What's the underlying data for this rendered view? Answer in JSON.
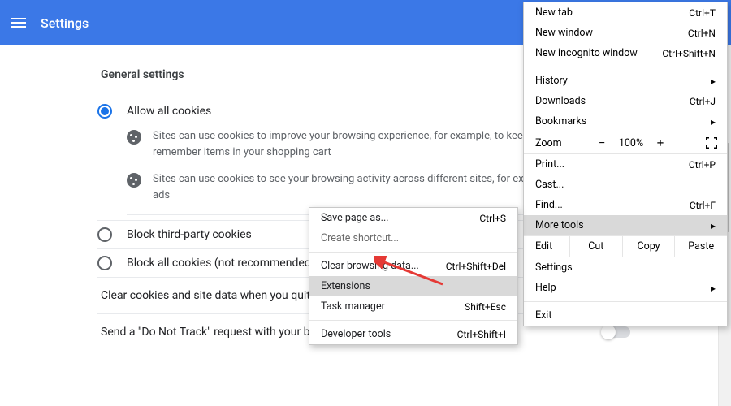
{
  "header": {
    "title": "Settings"
  },
  "section": {
    "title": "General settings",
    "options": [
      {
        "label": "Allow all cookies",
        "checked": true,
        "desc1": "Sites can use cookies to improve your browsing experience, for example, to keep you signed in or to remember items in your shopping cart",
        "desc2": "Sites can use cookies to see your browsing activity across different sites, for example, to personalize ads"
      },
      {
        "label": "Block third-party cookies",
        "checked": false
      },
      {
        "label": "Block all cookies (not recommended)",
        "checked": false
      }
    ],
    "toggles": [
      {
        "label": "Clear cookies and site data when you quit Chrome",
        "on": false
      },
      {
        "label": "Send a \"Do Not Track\" request with your browsing traffic",
        "on": false
      }
    ]
  },
  "menu": {
    "new_tab": {
      "label": "New tab",
      "shortcut": "Ctrl+T"
    },
    "new_window": {
      "label": "New window",
      "shortcut": "Ctrl+N"
    },
    "new_incognito": {
      "label": "New incognito window",
      "shortcut": "Ctrl+Shift+N"
    },
    "history": {
      "label": "History"
    },
    "downloads": {
      "label": "Downloads",
      "shortcut": "Ctrl+J"
    },
    "bookmarks": {
      "label": "Bookmarks"
    },
    "zoom": {
      "label": "Zoom",
      "minus": "−",
      "pct": "100%",
      "plus": "+"
    },
    "print": {
      "label": "Print...",
      "shortcut": "Ctrl+P"
    },
    "cast": {
      "label": "Cast..."
    },
    "find": {
      "label": "Find...",
      "shortcut": "Ctrl+F"
    },
    "more_tools": {
      "label": "More tools"
    },
    "edit": {
      "label": "Edit",
      "cut": "Cut",
      "copy": "Copy",
      "paste": "Paste"
    },
    "settings": {
      "label": "Settings"
    },
    "help": {
      "label": "Help"
    },
    "exit": {
      "label": "Exit"
    }
  },
  "submenu": {
    "save_page": {
      "label": "Save page as...",
      "shortcut": "Ctrl+S"
    },
    "create_shortcut": {
      "label": "Create shortcut..."
    },
    "clear_browsing": {
      "label": "Clear browsing data...",
      "shortcut": "Ctrl+Shift+Del"
    },
    "extensions": {
      "label": "Extensions"
    },
    "task_manager": {
      "label": "Task manager",
      "shortcut": "Shift+Esc"
    },
    "dev_tools": {
      "label": "Developer tools",
      "shortcut": "Ctrl+Shift+I"
    }
  }
}
